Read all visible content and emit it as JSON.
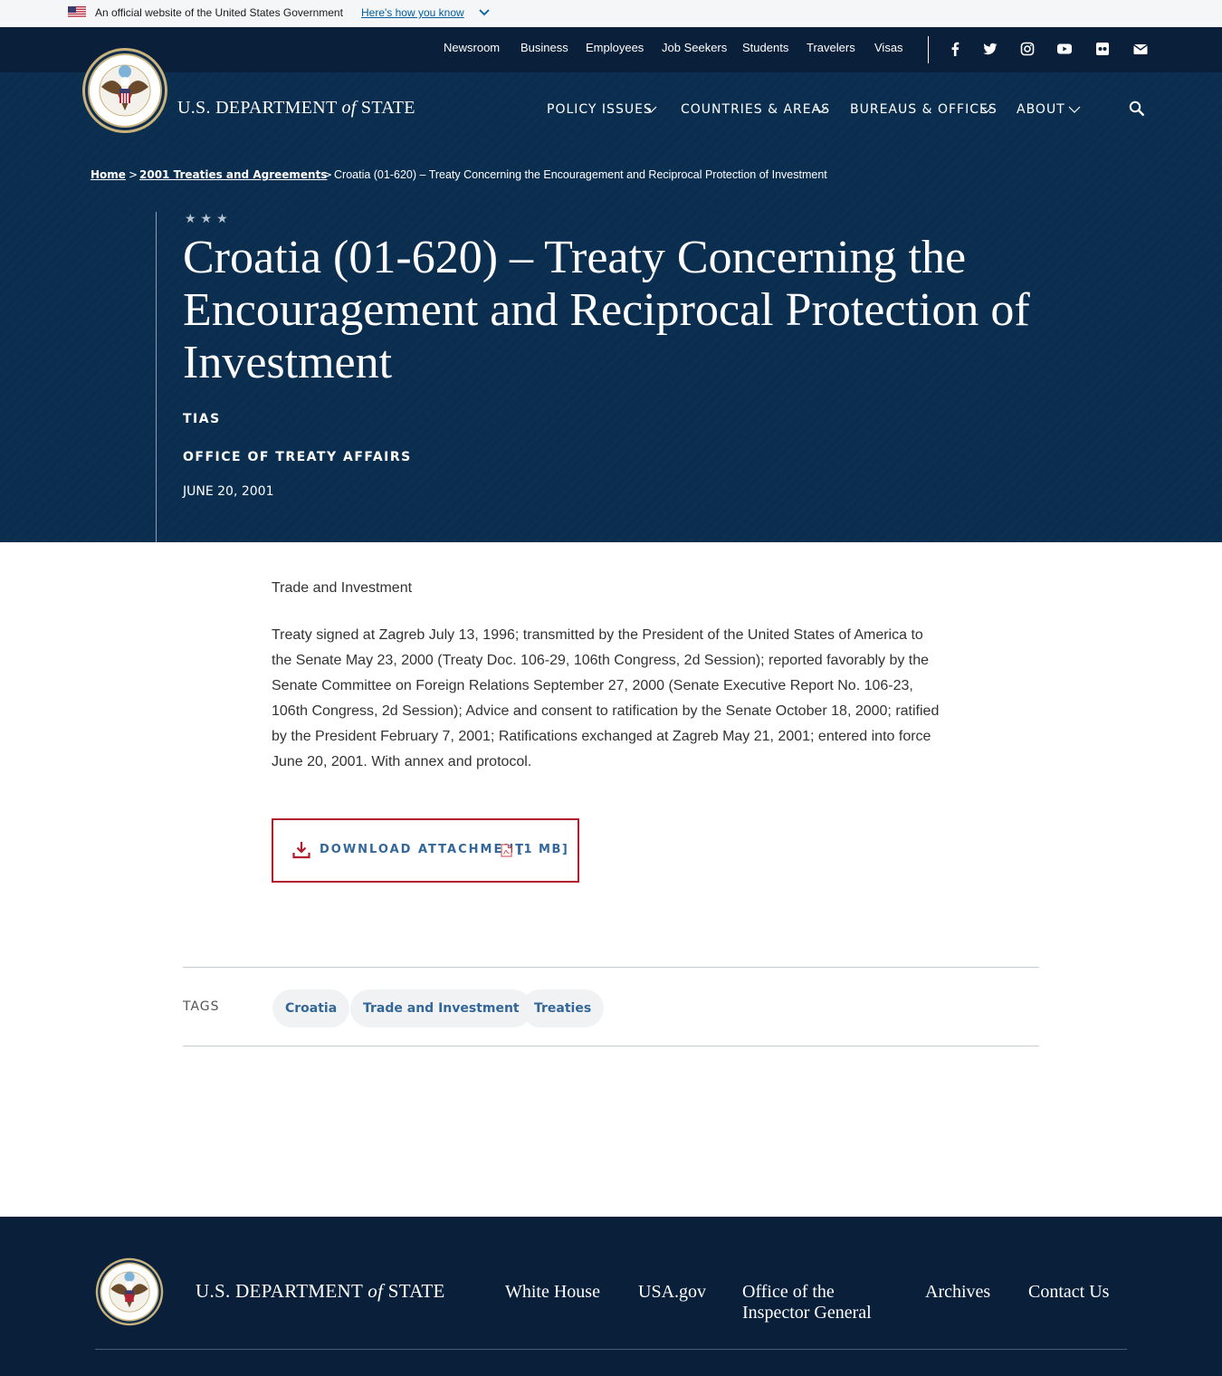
{
  "gov_banner": {
    "text": "An official website of the United States Government",
    "link": "Here's how you know"
  },
  "utility_nav": [
    "Newsroom",
    "Business",
    "Employees",
    "Job Seekers",
    "Students",
    "Travelers",
    "Visas"
  ],
  "social_icons": [
    "facebook-icon",
    "twitter-icon",
    "instagram-icon",
    "youtube-icon",
    "flickr-icon",
    "email-icon"
  ],
  "brand": {
    "pre": "U.S. DEPARTMENT",
    "of": "of",
    "post": "STATE"
  },
  "main_nav": [
    {
      "label": "POLICY ISSUES"
    },
    {
      "label": "COUNTRIES & AREAS"
    },
    {
      "label": "BUREAUS & OFFICES"
    },
    {
      "label": "ABOUT"
    }
  ],
  "breadcrumb": {
    "home": "Home",
    "parent": "2001 Treaties and Agreements",
    "current": "Croatia (01-620) – Treaty Concerning the Encouragement and Reciprocal Protection of Investment",
    "sep": ">"
  },
  "article": {
    "stars": "★★★",
    "title": "Croatia (01-620) – Treaty Concerning the Encouragement and Reciprocal Protection of Investment",
    "eyebrow": "TIAS",
    "office": "OFFICE OF TREATY AFFAIRS",
    "date": "JUNE 20, 2001",
    "category": "Trade and Investment",
    "body": "Treaty signed at Zagreb July 13, 1996; transmitted by the President of the United States of America to the Senate May 23, 2000 (Treaty Doc. 106-29, 106th Congress, 2d Session); reported favorably by the Senate Committee on Foreign Relations September 27, 2000 (Senate Executive Report No. 106-23, 106th Congress, 2d Session); Advice and consent to ratification by the Senate October 18, 2000; ratified by the President February 7, 2001; Ratifications exchanged at Zagreb May 21, 2001; entered into force June 20, 2001.  With annex and protocol."
  },
  "download": {
    "label": "DOWNLOAD ATTACHMENT",
    "size": "[1 MB]"
  },
  "tags": {
    "label": "TAGS",
    "items": [
      "Croatia",
      "Trade and Investment",
      "Treaties"
    ]
  },
  "footer": {
    "links": [
      "White House",
      "USA.gov",
      "Office of the Inspector General",
      "Archives",
      "Contact Us"
    ]
  },
  "colors": {
    "header_bg": "#0b2e4f",
    "utility_bg": "#0a1f3a",
    "accent_red": "#b3192d",
    "link_blue": "#336699"
  }
}
